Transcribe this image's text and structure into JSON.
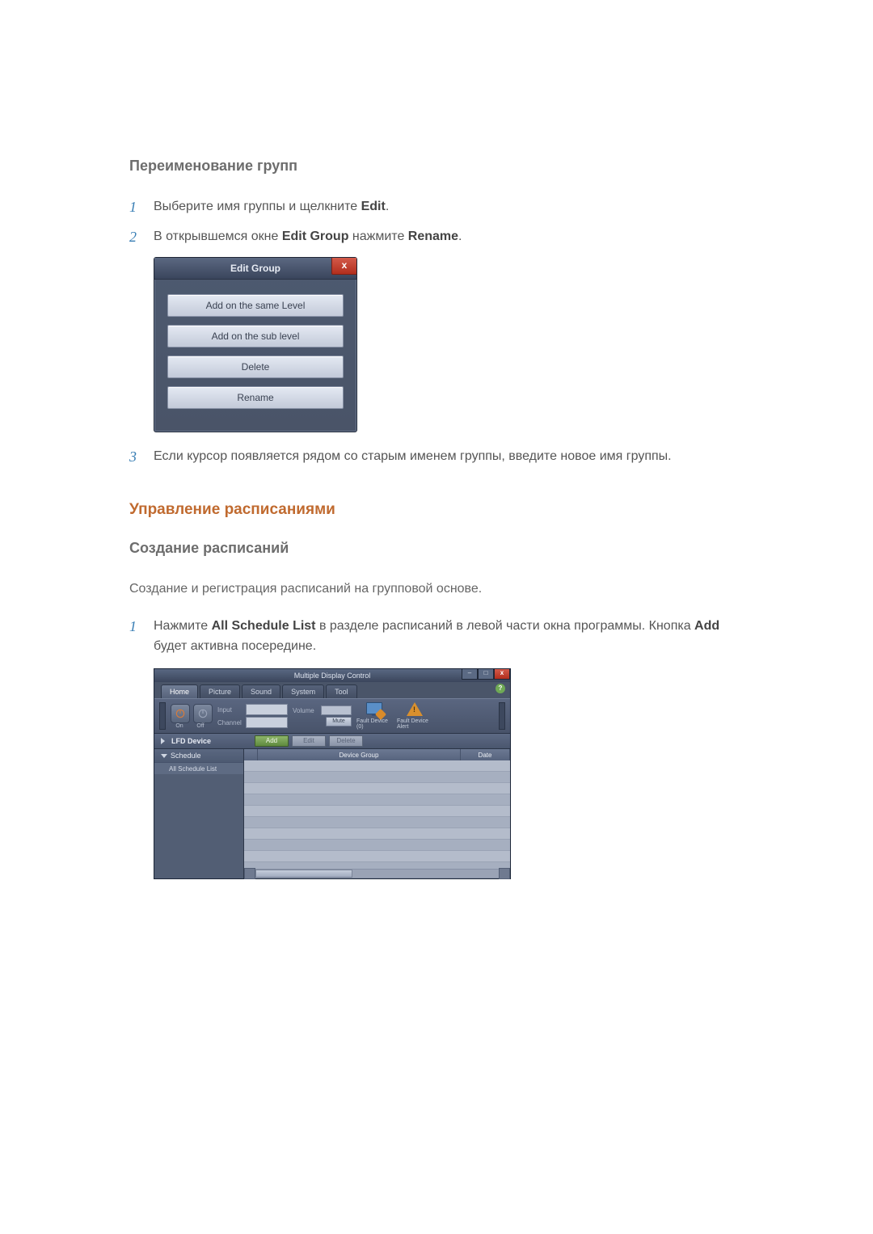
{
  "section_rename": {
    "heading": "Переименование групп",
    "steps": [
      {
        "n": "1",
        "pre": "Выберите имя группы и щелкните ",
        "b": "Edit",
        "post": "."
      },
      {
        "n": "2",
        "pre": "В открывшемся окне ",
        "b": "Edit Group",
        "mid": " нажмите ",
        "b2": "Rename",
        "post": "."
      },
      {
        "n": "3",
        "pre": "Если курсор появляется рядом со старым именем группы, введите новое имя группы."
      }
    ]
  },
  "edit_group_dialog": {
    "title": "Edit Group",
    "close": "x",
    "buttons": [
      "Add on the same Level",
      "Add on the sub level",
      "Delete",
      "Rename"
    ]
  },
  "section_sched": {
    "heading": "Управление расписаниями",
    "sub": "Создание расписаний",
    "intro": "Создание и регистрация расписаний на групповой основе.",
    "step1": {
      "n": "1",
      "pre": "Нажмите ",
      "b": "All Schedule List",
      "mid": " в разделе расписаний в левой части окна программы. Кнопка ",
      "b2": "Add",
      "post": " будет активна посередине."
    }
  },
  "mdc": {
    "title": "Multiple Display Control",
    "win": {
      "min": "–",
      "max": "□",
      "close": "x"
    },
    "help": "?",
    "tabs": [
      "Home",
      "Picture",
      "Sound",
      "System",
      "Tool"
    ],
    "active_tab": 0,
    "toolbar": {
      "power_on": "On",
      "power_off": "Off",
      "input_label": "Input",
      "channel_label": "Channel",
      "volume_label": "Volume",
      "mute": "Mute",
      "fault_device": "Fault Device (0)",
      "fault_alert": "Fault Device Alert"
    },
    "strip": {
      "lfd": "LFD Device",
      "add": "Add",
      "edit": "Edit",
      "delete": "Delete"
    },
    "tree": {
      "schedule": "Schedule",
      "all_list": "All Schedule List"
    },
    "grid": {
      "col_group": "Device Group",
      "col_date": "Date"
    }
  }
}
